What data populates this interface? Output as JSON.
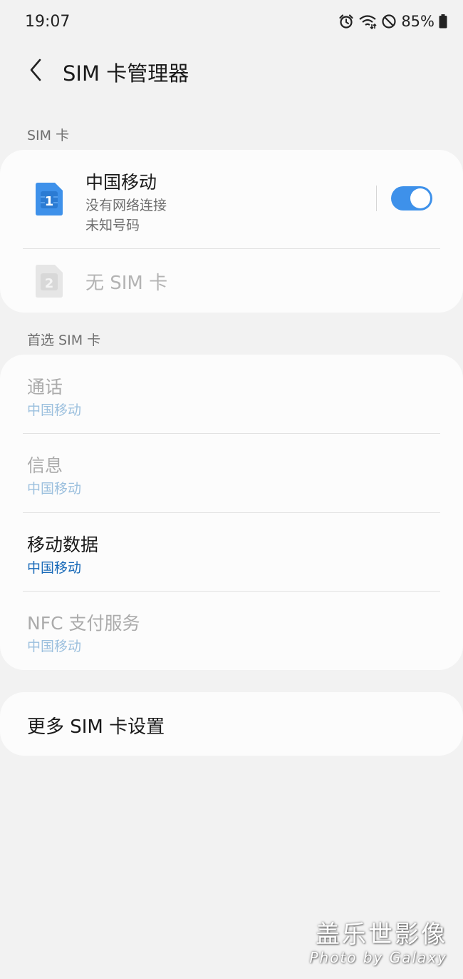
{
  "status_bar": {
    "time": "19:07",
    "battery": "85%",
    "icons": [
      "alarm-icon",
      "wifi-icon",
      "do-not-disturb-icon",
      "battery-icon"
    ]
  },
  "header": {
    "title": "SIM 卡管理器",
    "back_icon": "chevron-left-icon"
  },
  "sim_section": {
    "label": "SIM 卡",
    "sim1": {
      "number": "1",
      "carrier": "中国移动",
      "status": "没有网络连接",
      "phone_number": "未知号码",
      "enabled": true
    },
    "sim2": {
      "number": "2",
      "label": "无 SIM 卡"
    }
  },
  "preferred_section": {
    "label": "首选 SIM 卡",
    "items": [
      {
        "title": "通话",
        "value": "中国移动",
        "enabled": false
      },
      {
        "title": "信息",
        "value": "中国移动",
        "enabled": false
      },
      {
        "title": "移动数据",
        "value": "中国移动",
        "enabled": true
      },
      {
        "title": "NFC 支付服务",
        "value": "中国移动",
        "enabled": false
      }
    ]
  },
  "more_settings": {
    "label": "更多 SIM 卡设置"
  },
  "watermark": {
    "main": "盖乐世影像",
    "sub": "Photo by Galaxy"
  },
  "colors": {
    "accent": "#3e91ea",
    "link": "#1769b8",
    "background": "#f2f2f2",
    "card": "#fcfcfc"
  }
}
